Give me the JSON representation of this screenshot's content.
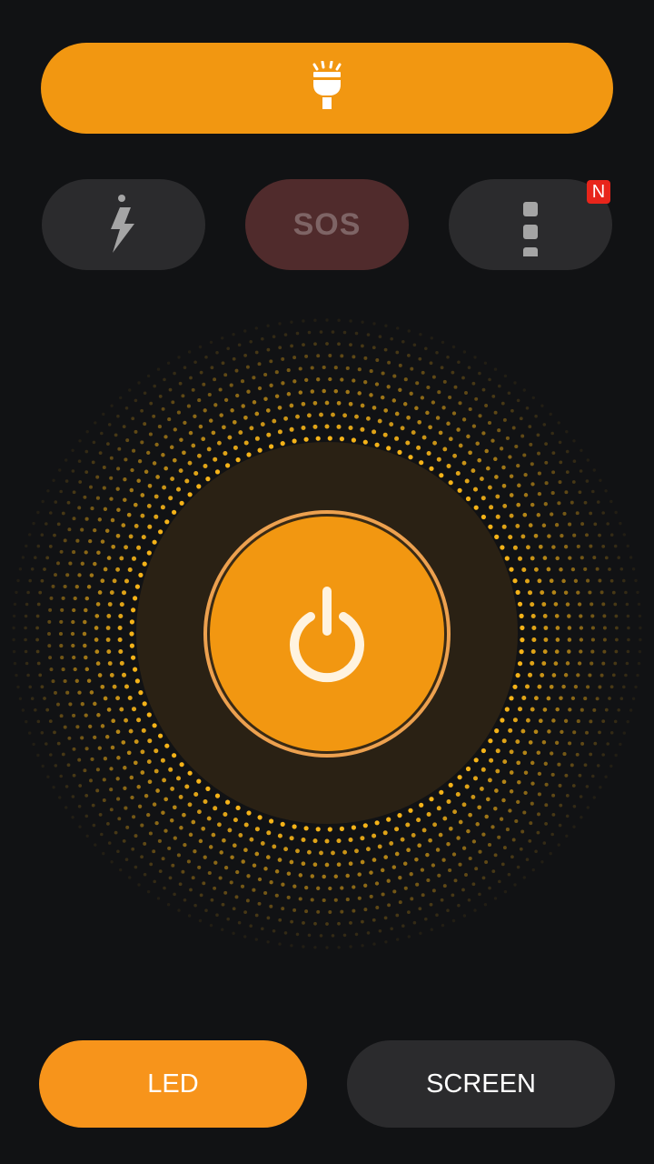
{
  "top_bar": {
    "icon": "flashlight-icon"
  },
  "mode_pills": [
    {
      "icon": "strobe-icon"
    },
    {
      "label": "SOS"
    },
    {
      "icon": "more-vert-icon",
      "badge": "N"
    }
  ],
  "power": {
    "icon": "power-icon"
  },
  "bottom": {
    "led_label": "LED",
    "screen_label": "SCREEN"
  },
  "colors": {
    "accent": "#F29711",
    "background": "#111214",
    "pill": "#2B2B2D",
    "sos_pill": "#502B2C",
    "badge": "#E8251B"
  }
}
